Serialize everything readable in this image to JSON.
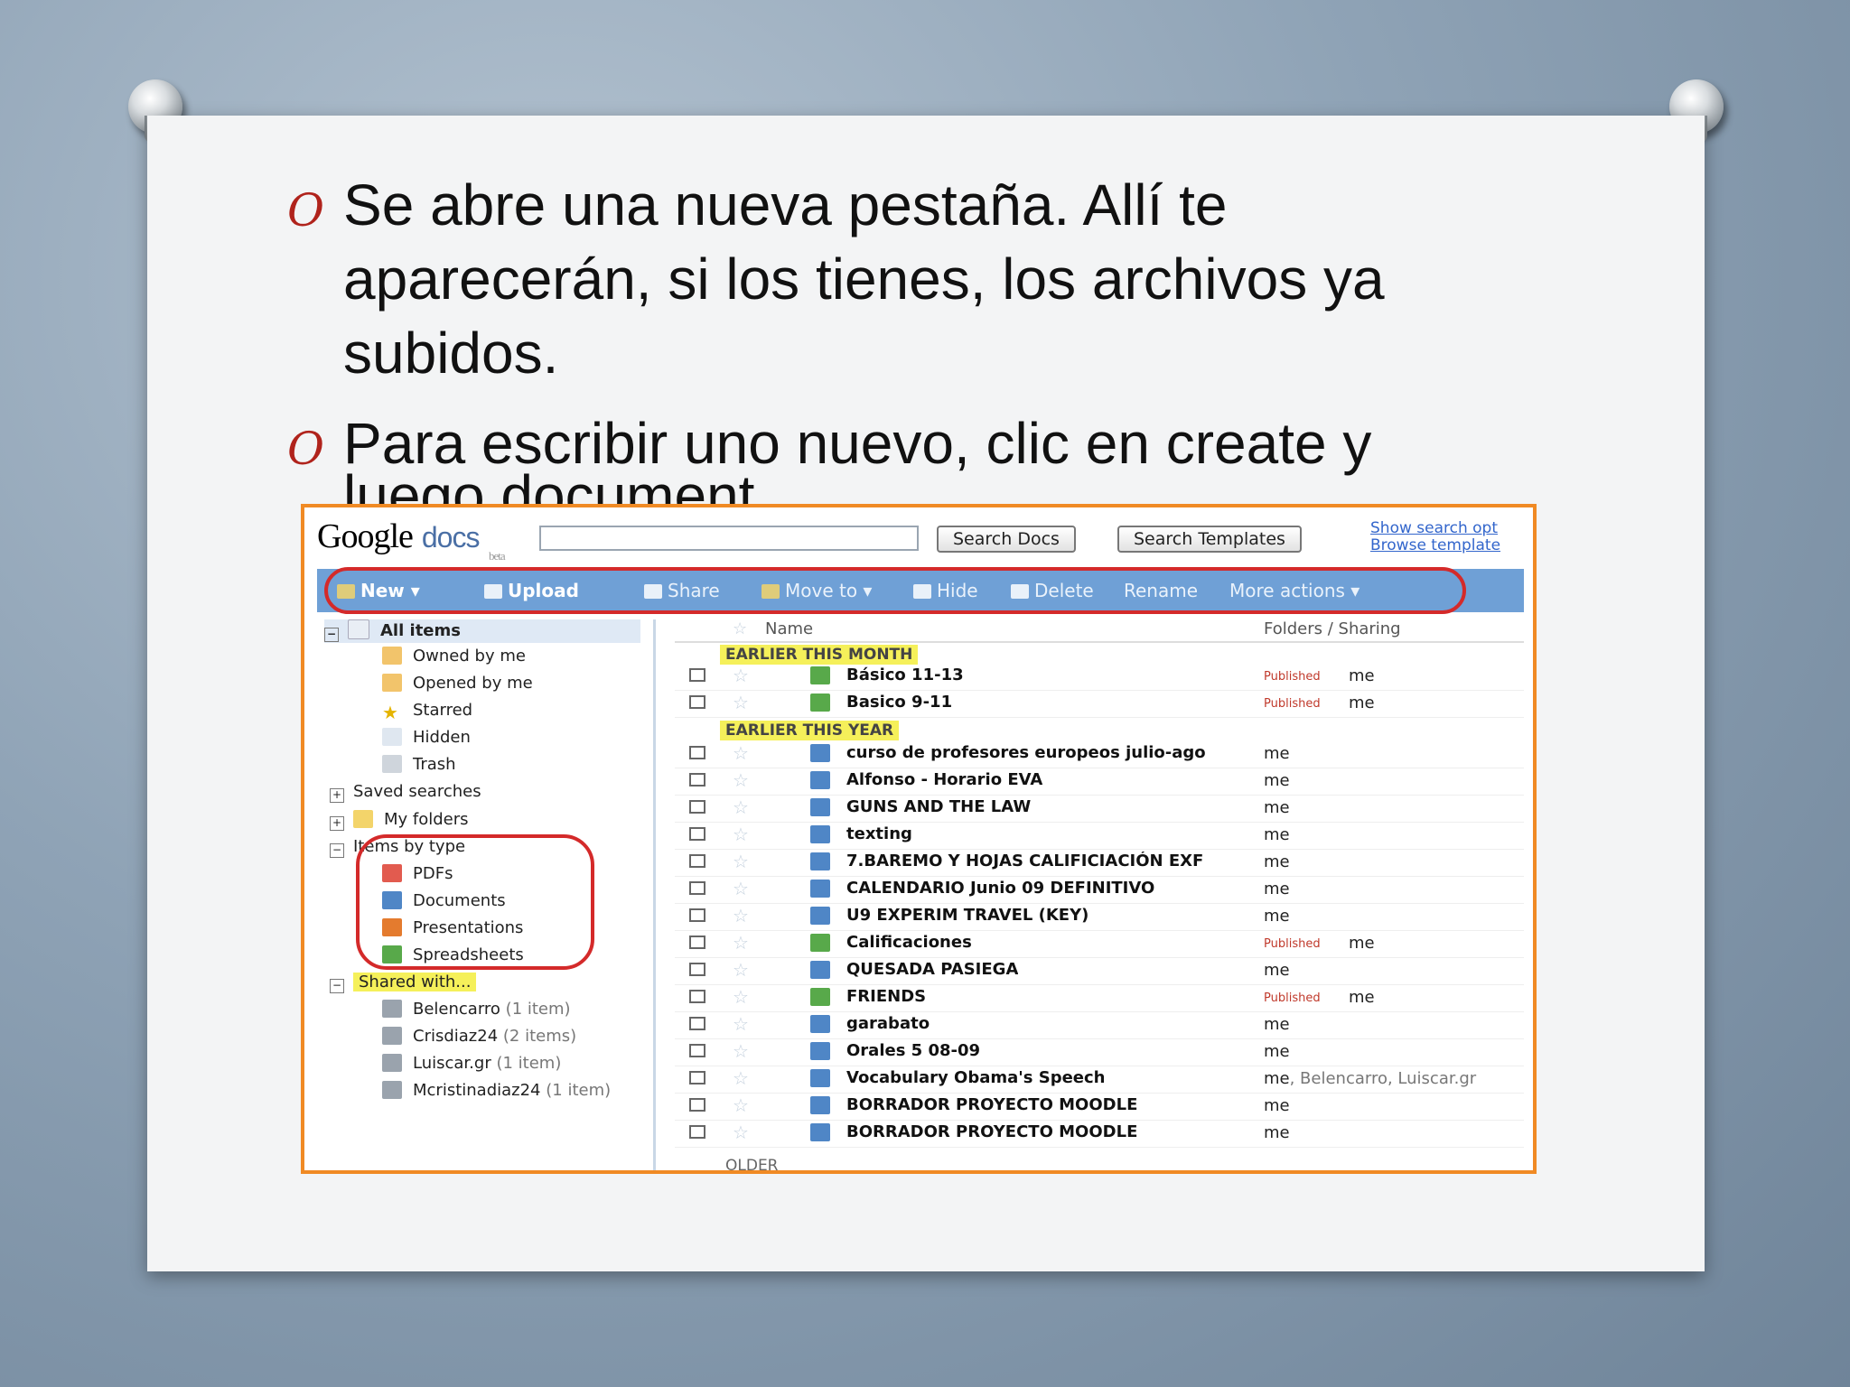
{
  "slide": {
    "bullet_mark": "O",
    "bullets": [
      "Se abre una nueva pestaña. Allí te aparecerán, si los tienes, los archivos ya subidos.",
      "Para escribir uno nuevo, clic en create y"
    ],
    "clipped_line": "luego document"
  },
  "gdocs": {
    "logo": "Google",
    "logo_docs": "docs",
    "logo_beta": "beta",
    "search_docs_label": "Search Docs",
    "search_templates_label": "Search Templates",
    "link_search_options": "Show search opt",
    "link_browse_templates": "Browse template",
    "toolbar": {
      "new": "New",
      "upload": "Upload",
      "share": "Share",
      "move_to": "Move to",
      "hide": "Hide",
      "delete": "Delete",
      "rename": "Rename",
      "more_actions": "More actions"
    },
    "sidebar": {
      "all_items": "All items",
      "owned_by_me": "Owned by me",
      "opened_by_me": "Opened by me",
      "starred": "Starred",
      "hidden": "Hidden",
      "trash": "Trash",
      "saved_searches": "Saved searches",
      "my_folders": "My folders",
      "items_by_type": "Items by type",
      "pdfs": "PDFs",
      "documents": "Documents",
      "presentations": "Presentations",
      "spreadsheets": "Spreadsheets",
      "shared_with": "Shared with...",
      "shared_users": [
        {
          "name": "Belencarro",
          "count": "(1 item)"
        },
        {
          "name": "Crisdiaz24",
          "count": "(2 items)"
        },
        {
          "name": "Luiscar.gr",
          "count": "(1 item)"
        },
        {
          "name": "Mcristinadiaz24",
          "count": "(1 item)"
        }
      ]
    },
    "columns": {
      "name": "Name",
      "folders_sharing": "Folders / Sharing"
    },
    "groups": {
      "earlier_month": "EARLIER THIS MONTH",
      "earlier_year": "EARLIER THIS YEAR",
      "older": "OLDER"
    },
    "published_label": "Published",
    "files": [
      {
        "name": "Básico 11-13",
        "kind": "spreadsheet",
        "published": true,
        "sharing": "me"
      },
      {
        "name": "Basico 9-11",
        "kind": "spreadsheet",
        "published": true,
        "sharing": "me"
      },
      {
        "name": "curso de profesores europeos julio-ago",
        "kind": "document",
        "published": false,
        "sharing": "me"
      },
      {
        "name": "Alfonso - Horario EVA",
        "kind": "document",
        "published": false,
        "sharing": "me"
      },
      {
        "name": "GUNS AND THE LAW",
        "kind": "document",
        "published": false,
        "sharing": "me"
      },
      {
        "name": "texting",
        "kind": "document",
        "published": false,
        "sharing": "me"
      },
      {
        "name": "7.BAREMO Y HOJAS CALIFICIACIÓN EXF",
        "kind": "document",
        "published": false,
        "sharing": "me"
      },
      {
        "name": "CALENDARIO Junio 09 DEFINITIVO",
        "kind": "document",
        "published": false,
        "sharing": "me"
      },
      {
        "name": "U9 EXPERIM TRAVEL (KEY)",
        "kind": "document",
        "published": false,
        "sharing": "me"
      },
      {
        "name": "Calificaciones",
        "kind": "spreadsheet",
        "published": true,
        "sharing": "me"
      },
      {
        "name": "QUESADA PASIEGA",
        "kind": "document",
        "published": false,
        "sharing": "me"
      },
      {
        "name": "FRIENDS",
        "kind": "spreadsheet",
        "published": true,
        "sharing": "me"
      },
      {
        "name": "garabato",
        "kind": "document",
        "published": false,
        "sharing": "me"
      },
      {
        "name": "Orales 5 08-09",
        "kind": "document",
        "published": false,
        "sharing": "me"
      },
      {
        "name": "Vocabulary Obama's Speech",
        "kind": "document",
        "published": false,
        "sharing": "me",
        "sharing_extra": ", Belencarro, Luiscar.gr"
      },
      {
        "name": "BORRADOR PROYECTO MOODLE",
        "kind": "document",
        "published": false,
        "sharing": "me"
      },
      {
        "name": "BORRADOR PROYECTO MOODLE",
        "kind": "document",
        "published": false,
        "sharing": "me"
      }
    ],
    "colors": {
      "toolbar": "#6fa0d6",
      "frame": "#f08a24",
      "highlight": "#f5f05a",
      "annotation": "#d42a2a",
      "bullet_mark": "#b0231c"
    }
  }
}
